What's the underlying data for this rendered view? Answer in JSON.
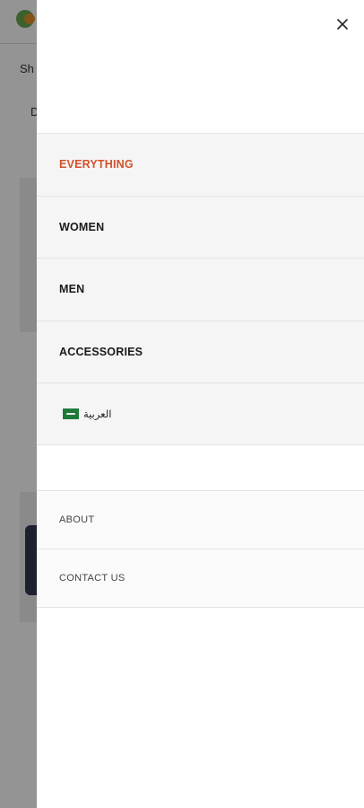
{
  "background": {
    "shop_text": "Sh",
    "d_text": "D"
  },
  "drawer": {
    "close_icon": "close-icon",
    "primary_menu": [
      {
        "label": "EVERYTHING",
        "active": true
      },
      {
        "label": "WOMEN",
        "active": false
      },
      {
        "label": "MEN",
        "active": false
      },
      {
        "label": "ACCESSORIES",
        "active": false
      }
    ],
    "language": {
      "flag_icon": "saudi-flag-icon",
      "label": "العربية"
    },
    "secondary_menu": [
      {
        "label": "ABOUT"
      },
      {
        "label": "CONTACT US"
      }
    ],
    "colors": {
      "active": "#d2522a",
      "text": "#1a1a1a"
    }
  }
}
